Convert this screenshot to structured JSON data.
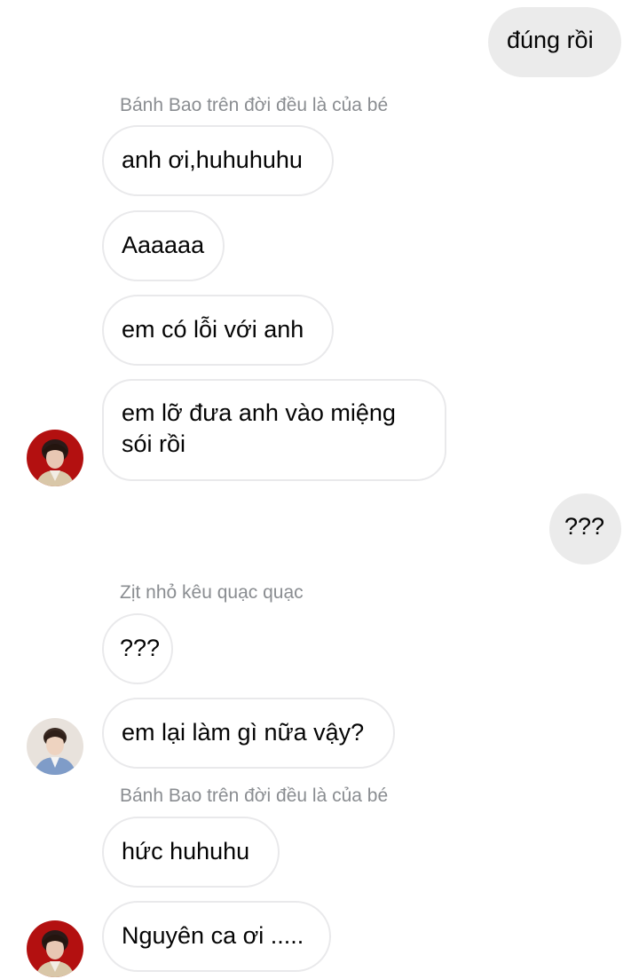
{
  "messages": {
    "m1": "đúng rồi",
    "s1": "Bánh Bao trên đời đều là của bé",
    "m2": "anh ơi,huhuhuhu",
    "m3": "Aaaaaa",
    "m4": "em có lỗi với anh",
    "m5": "em lỡ đưa anh vào miệng sói rồi",
    "m6": "???",
    "s2": "Zịt nhỏ kêu quạc quạc",
    "m7": "???",
    "m8": "em lại làm gì nữa vậy?",
    "s3": "Bánh Bao trên đời đều là của bé",
    "m9": "hức huhuhu",
    "m10": "Nguyên ca ơi ....."
  },
  "colors": {
    "outgoing_bubble": "#ebebeb",
    "incoming_border": "#e9e9eb",
    "sender_name": "#8a8d91",
    "avatar_red": "#b31010"
  }
}
